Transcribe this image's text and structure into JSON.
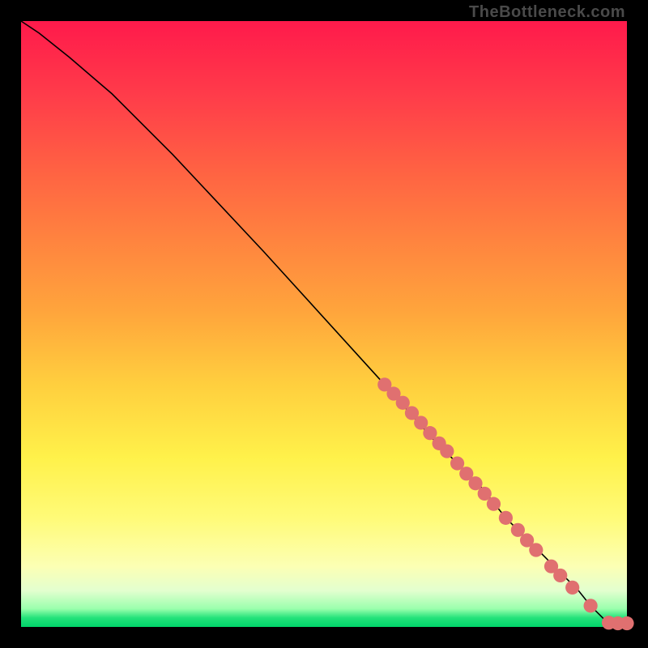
{
  "watermark": "TheBottleneck.com",
  "chart_data": {
    "type": "line",
    "title": "",
    "xlabel": "",
    "ylabel": "",
    "xlim": [
      0,
      100
    ],
    "ylim": [
      0,
      100
    ],
    "series": [
      {
        "name": "curve",
        "x": [
          0,
          3,
          8,
          15,
          25,
          40,
          60,
          68,
          72,
          76,
          80,
          83,
          86,
          88,
          90,
          92,
          94,
          95.5,
          97,
          100
        ],
        "y": [
          100,
          98,
          94,
          88,
          78,
          62,
          40,
          31,
          27,
          23,
          18,
          15,
          12,
          10,
          8,
          6,
          3.5,
          2,
          0.5,
          0.5
        ]
      }
    ],
    "scatter": {
      "name": "dots",
      "color": "#e07070",
      "points": [
        {
          "x": 60,
          "y": 40
        },
        {
          "x": 61.5,
          "y": 38.5
        },
        {
          "x": 63,
          "y": 37
        },
        {
          "x": 64.5,
          "y": 35.3
        },
        {
          "x": 66,
          "y": 33.7
        },
        {
          "x": 67.5,
          "y": 32
        },
        {
          "x": 69,
          "y": 30.3
        },
        {
          "x": 70.3,
          "y": 29
        },
        {
          "x": 72,
          "y": 27
        },
        {
          "x": 73.5,
          "y": 25.3
        },
        {
          "x": 75,
          "y": 23.7
        },
        {
          "x": 76.5,
          "y": 22
        },
        {
          "x": 78,
          "y": 20.3
        },
        {
          "x": 80,
          "y": 18
        },
        {
          "x": 82,
          "y": 16
        },
        {
          "x": 83.5,
          "y": 14.3
        },
        {
          "x": 85,
          "y": 12.7
        },
        {
          "x": 87.5,
          "y": 10
        },
        {
          "x": 89,
          "y": 8.5
        },
        {
          "x": 91,
          "y": 6.5
        },
        {
          "x": 94,
          "y": 3.5
        },
        {
          "x": 97,
          "y": 0.7
        },
        {
          "x": 98.5,
          "y": 0.6
        },
        {
          "x": 100,
          "y": 0.6
        }
      ]
    }
  }
}
